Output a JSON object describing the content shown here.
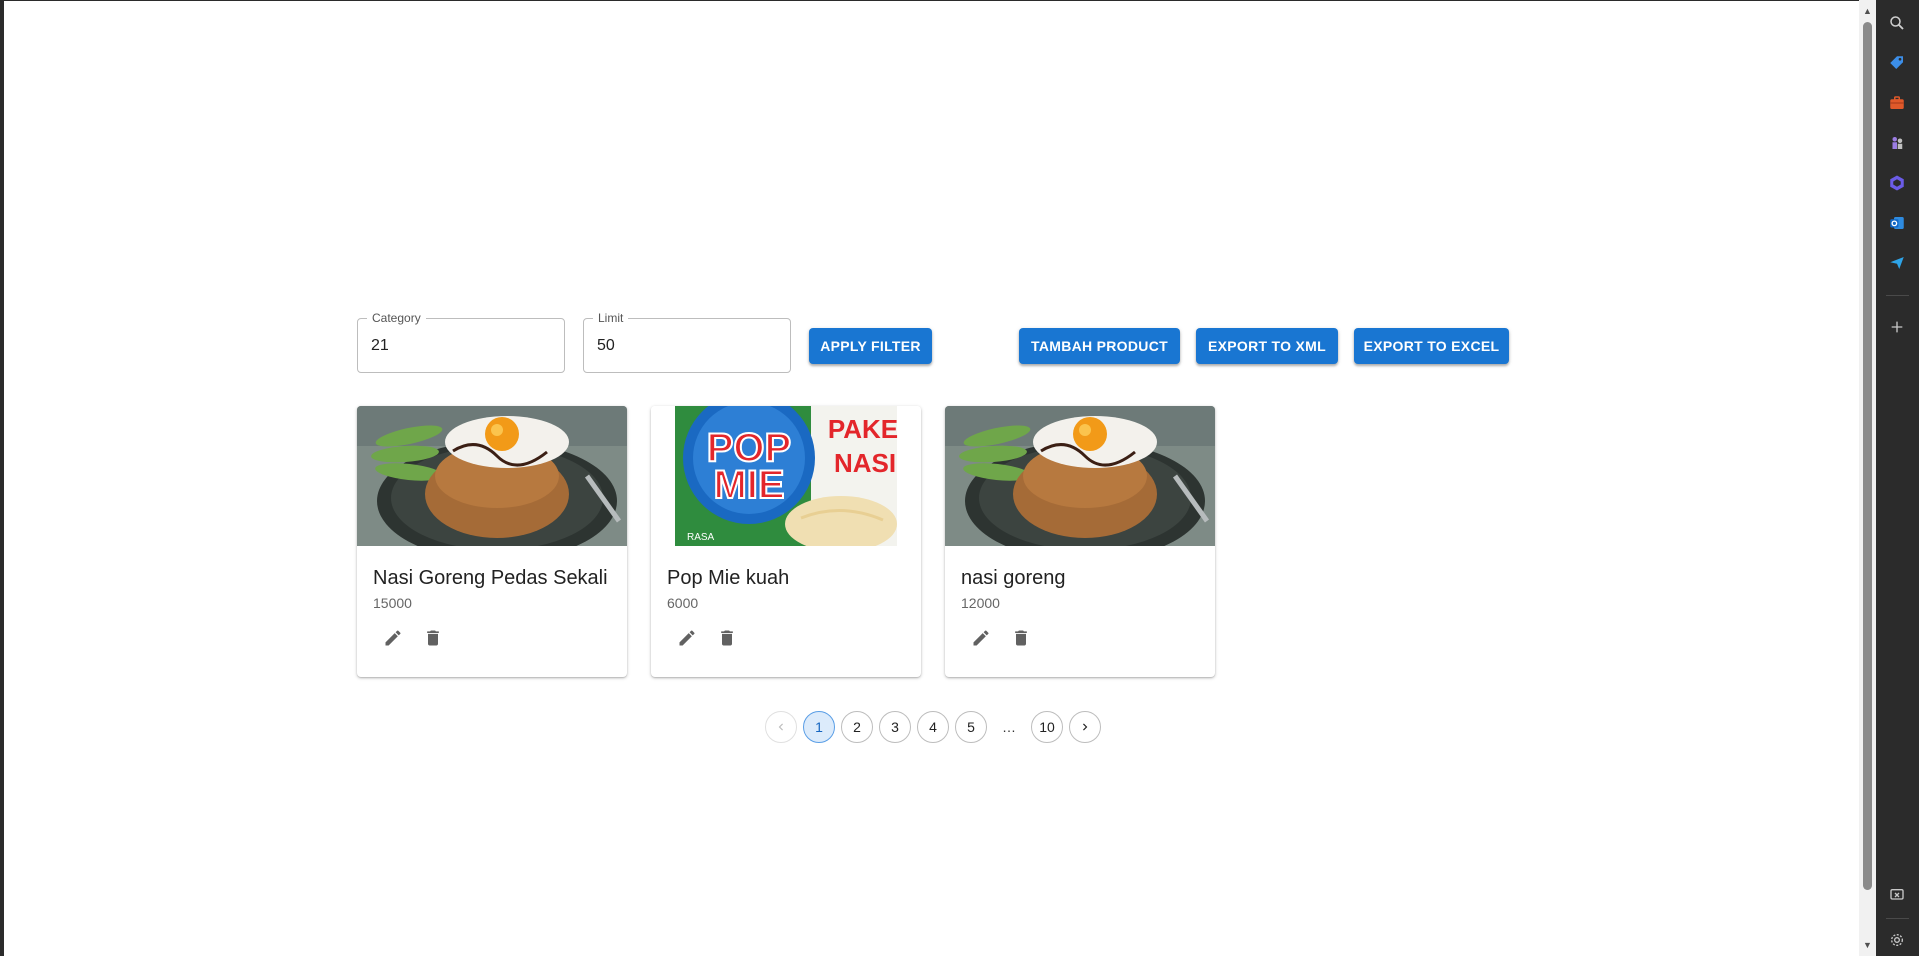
{
  "filters": {
    "category": {
      "label": "Category",
      "value": "21"
    },
    "limit": {
      "label": "Limit",
      "value": "50"
    },
    "apply_label": "APPLY FILTER"
  },
  "actions": {
    "add_product_label": "TAMBAH PRODUCT",
    "export_xml_label": "EXPORT TO XML",
    "export_excel_label": "EXPORT TO EXCEL"
  },
  "products": [
    {
      "name": "Nasi Goreng Pedas Sekali",
      "price": "15000",
      "image": "fried-rice-with-egg"
    },
    {
      "name": "Pop Mie kuah",
      "price": "6000",
      "image": "pop-mie-cup"
    },
    {
      "name": "nasi goreng",
      "price": "12000",
      "image": "fried-rice-with-egg"
    }
  ],
  "pop_mie_art": {
    "brand_top": "POP",
    "brand_bottom": "MIE",
    "side_top": "PAKE",
    "side_bottom": "NASI",
    "side_small": "RASA"
  },
  "pagination": {
    "pages": [
      "1",
      "2",
      "3",
      "4",
      "5"
    ],
    "ellipsis": "…",
    "last": "10",
    "current": "1"
  },
  "colors": {
    "primary": "#1976d2",
    "sidebar": "#2b2b2b"
  },
  "edge_sidebar_icons": [
    "search-icon",
    "tag-icon",
    "briefcase-icon",
    "chess-icon",
    "copilot-icon",
    "outlook-icon",
    "send-icon",
    "add-icon",
    "screenshot-icon",
    "settings-icon"
  ]
}
